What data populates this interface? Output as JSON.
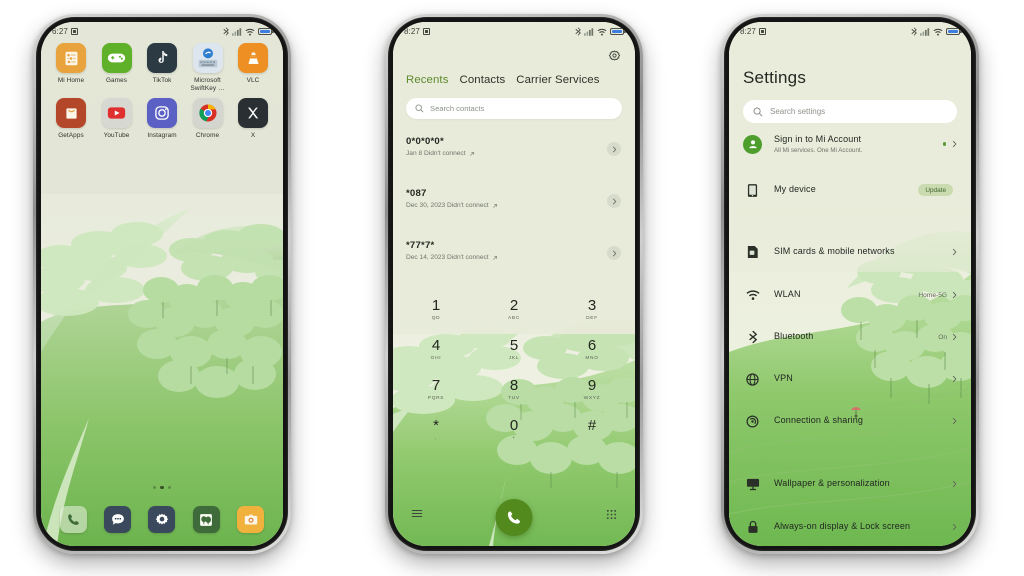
{
  "statusbar": {
    "time_home": "6:27",
    "time_dialer": "8:27",
    "time_settings": "8:27",
    "icons": [
      "bluetooth-icon",
      "signal-icon",
      "wifi-icon",
      "battery-icon"
    ]
  },
  "home": {
    "apps_row1": [
      {
        "label": "Mi Home",
        "icon": "mi-home-icon"
      },
      {
        "label": "Games",
        "icon": "games-icon"
      },
      {
        "label": "TikTok",
        "icon": "tiktok-icon"
      },
      {
        "label": "Microsoft SwiftKey …",
        "icon": "swiftkey-icon"
      },
      {
        "label": "VLC",
        "icon": "vlc-icon"
      }
    ],
    "apps_row2": [
      {
        "label": "GetApps",
        "icon": "getapps-icon"
      },
      {
        "label": "YouTube",
        "icon": "youtube-icon"
      },
      {
        "label": "Instagram",
        "icon": "instagram-icon"
      },
      {
        "label": "Chrome",
        "icon": "chrome-icon"
      },
      {
        "label": "X",
        "icon": "x-icon"
      }
    ],
    "dock": [
      "phone-icon",
      "messages-icon",
      "settings-icon",
      "gallery-icon",
      "camera-icon"
    ],
    "page_dots": 3,
    "active_dot": 2
  },
  "dialer": {
    "gear": "settings-gear-icon",
    "tabs": [
      {
        "label": "Recents",
        "active": true
      },
      {
        "label": "Contacts",
        "active": false
      },
      {
        "label": "Carrier Services",
        "active": false
      }
    ],
    "search": {
      "placeholder": "Search contacts",
      "value": ""
    },
    "calls": [
      {
        "number": "0*0*0*0*",
        "detail": "Jan 8 Didn't connect"
      },
      {
        "number": "*087",
        "detail": "Dec 30, 2023 Didn't connect"
      },
      {
        "number": "*77*7*",
        "detail": "Dec 14, 2023 Didn't connect"
      }
    ],
    "keypad": [
      {
        "digit": "1",
        "letters": "QD"
      },
      {
        "digit": "2",
        "letters": "ABC"
      },
      {
        "digit": "3",
        "letters": "DEF"
      },
      {
        "digit": "4",
        "letters": "GHI"
      },
      {
        "digit": "5",
        "letters": "JKL"
      },
      {
        "digit": "6",
        "letters": "MNO"
      },
      {
        "digit": "7",
        "letters": "PQRS"
      },
      {
        "digit": "8",
        "letters": "TUV"
      },
      {
        "digit": "9",
        "letters": "WXYZ"
      },
      {
        "digit": "*",
        "letters": ","
      },
      {
        "digit": "0",
        "letters": "+"
      },
      {
        "digit": "#",
        "letters": ""
      }
    ],
    "call_button": "call-icon",
    "menu_icon": "hamburger-menu-icon",
    "keypad_icon": "dialpad-icon",
    "accent_green": "#5e8a2f",
    "fab_green": "#538a1e"
  },
  "settings": {
    "title": "Settings",
    "search": {
      "placeholder": "Search settings",
      "value": ""
    },
    "items": [
      {
        "label": "Sign in to Mi Account",
        "sub": "All Mi services. One Mi Account.",
        "value": "",
        "badge": "",
        "icon": "account-avatar-icon",
        "dot": true
      },
      {
        "label": "My device",
        "sub": "",
        "value": "",
        "badge": "Update",
        "icon": "device-icon",
        "dot": false
      },
      {
        "label": "SIM cards & mobile networks",
        "sub": "",
        "value": "",
        "badge": "",
        "icon": "sim-card-icon",
        "dot": false
      },
      {
        "label": "WLAN",
        "sub": "",
        "value": "Home-5G",
        "badge": "",
        "icon": "wifi-icon",
        "dot": false
      },
      {
        "label": "Bluetooth",
        "sub": "",
        "value": "On",
        "badge": "",
        "icon": "bluetooth-icon",
        "dot": false
      },
      {
        "label": "VPN",
        "sub": "",
        "value": "",
        "badge": "",
        "icon": "globe-icon",
        "dot": false
      },
      {
        "label": "Connection & sharing",
        "sub": "",
        "value": "",
        "badge": "",
        "icon": "sharing-icon",
        "dot": false
      },
      {
        "label": "Wallpaper & personalization",
        "sub": "",
        "value": "",
        "badge": "",
        "icon": "monitor-icon",
        "dot": false
      },
      {
        "label": "Always-on display & Lock screen",
        "sub": "",
        "value": "",
        "badge": "",
        "icon": "lock-icon",
        "dot": false
      }
    ],
    "accent_green": "#4e9e2e"
  }
}
